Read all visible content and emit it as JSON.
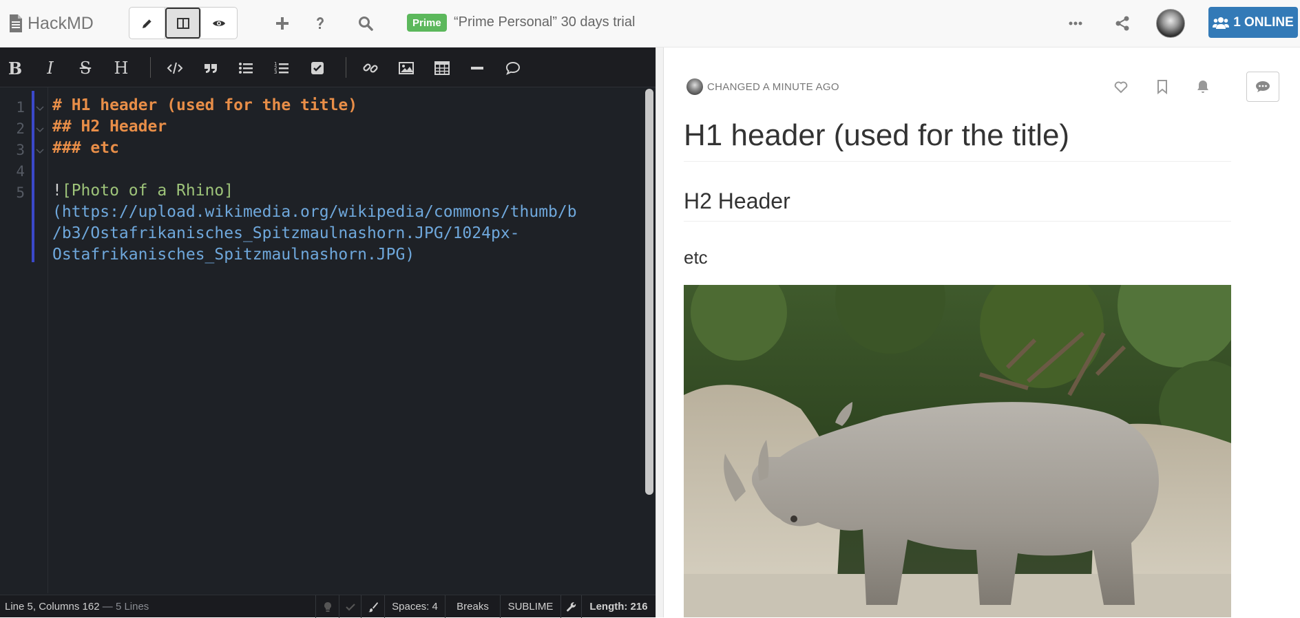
{
  "topbar": {
    "brand": "HackMD",
    "prime_badge": "Prime",
    "prime_text": "“Prime Personal” 30 days trial",
    "online_label": "1 ONLINE"
  },
  "toolbar": {
    "bold": "B",
    "italic": "I",
    "strike": "S",
    "heading": "H"
  },
  "editor": {
    "line_numbers": [
      "1",
      "2",
      "3",
      "4",
      "5"
    ],
    "lines": {
      "l1": "# H1 header (used for the title)",
      "l2": "## H2 Header",
      "l3": "### etc",
      "l5_bang": "!",
      "l5_alt": "[Photo of a Rhino]",
      "l5_url_a": "(https://upload.wikimedia.org/wikipedia/commons/thumb/b",
      "l5_url_b": "/b3/Ostafrikanisches_Spitzmaulnashorn.JPG/1024px-",
      "l5_url_c": "Ostafrikanisches_Spitzmaulnashorn.JPG)"
    }
  },
  "status": {
    "position": "Line 5, Columns 162",
    "separator": " — ",
    "lines": "5 Lines",
    "spaces": "Spaces: 4",
    "breaks": "Breaks",
    "keymap": "SUBLIME",
    "length": "Length: 216"
  },
  "preview": {
    "changed": "CHANGED A MINUTE AGO",
    "h1": "H1 header (used for the title)",
    "h2": "H2 Header",
    "h3": "etc"
  },
  "colors": {
    "editor_bg": "#1e2126",
    "header_syntax": "#e88e48",
    "alt_syntax": "#9ec47a",
    "url_syntax": "#6fa8dc",
    "online_button": "#337ab7",
    "prime_badge": "#5cb85c"
  }
}
